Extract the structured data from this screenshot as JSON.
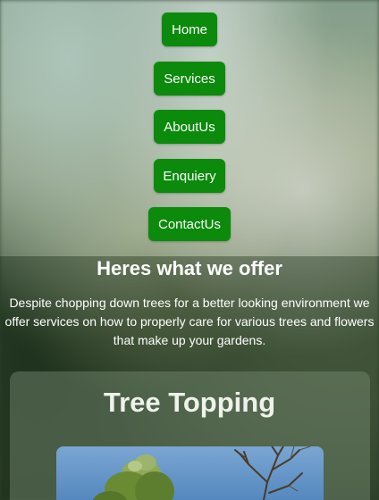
{
  "nav": {
    "home": "Home",
    "services": "Services",
    "about": "AboutUs",
    "enquiry": "Enquiery",
    "contact": "ContactUs"
  },
  "offer": {
    "title": "Heres what we offer",
    "description": "Despite chopping down trees for a better looking environment we offer services on how to properly care for various trees and flowers that make up your gardens."
  },
  "card": {
    "title": "Tree Topping",
    "image_alt": "tree-topping-photo"
  }
}
